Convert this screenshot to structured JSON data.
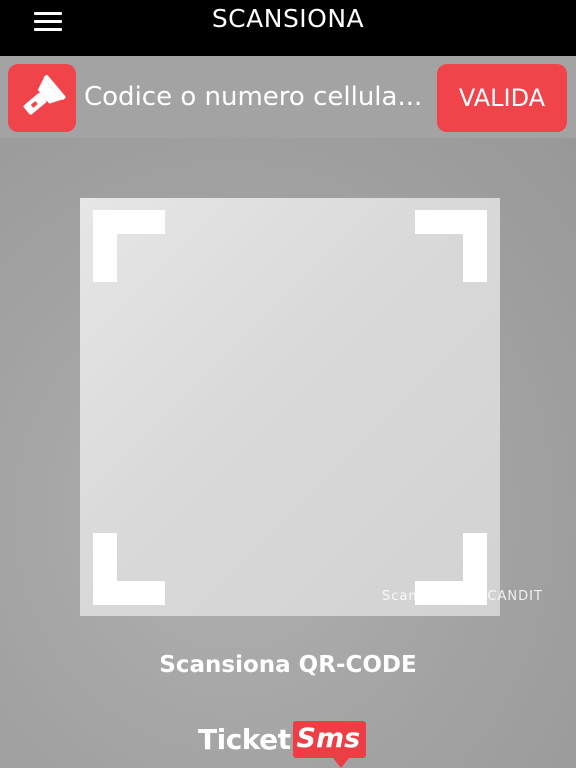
{
  "header": {
    "title": "SCANSIONA",
    "menu_icon": "hamburger-menu-icon"
  },
  "search": {
    "torch_icon": "flashlight-icon",
    "placeholder": "Codice o numero cellula...",
    "value": "",
    "validate_label": "VALIDA"
  },
  "scanner": {
    "watermark": "Scanning by SCANDIT",
    "instruction": "Scansiona QR-CODE"
  },
  "brand": {
    "part1": "Ticket",
    "part2": "Sms"
  },
  "colors": {
    "accent": "#f0444a",
    "topbar": "#000000"
  }
}
